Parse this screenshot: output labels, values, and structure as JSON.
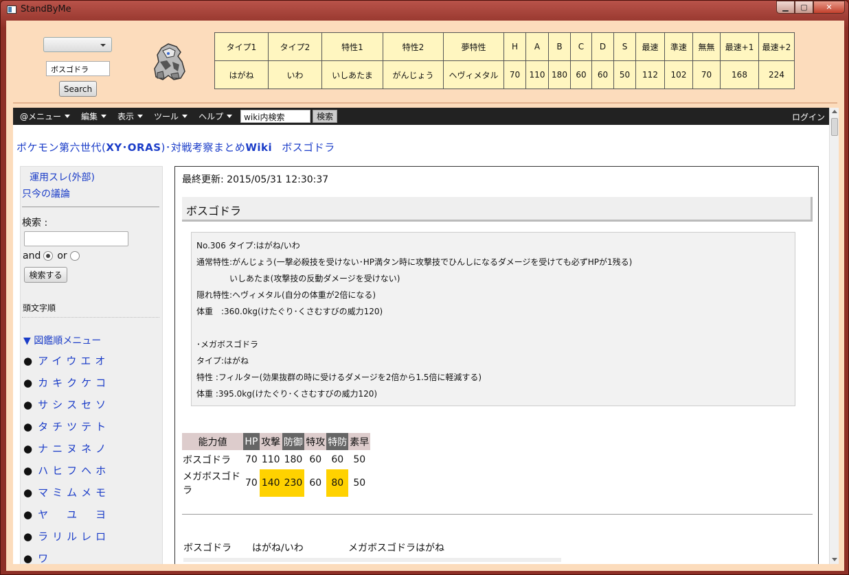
{
  "window": {
    "title": "StandByMe"
  },
  "panel": {
    "combo_value": "",
    "name_input": "ボスゴドラ",
    "search_label": "Search",
    "stats_headers": [
      "タイプ1",
      "タイプ2",
      "特性1",
      "特性2",
      "夢特性",
      "H",
      "A",
      "B",
      "C",
      "D",
      "S",
      "最速",
      "準速",
      "無無",
      "最速+1",
      "最速+2"
    ],
    "stats_values": [
      "はがね",
      "いわ",
      "いしあたま",
      "がんじょう",
      "ヘヴィメタル",
      "70",
      "110",
      "180",
      "60",
      "60",
      "50",
      "112",
      "102",
      "70",
      "168",
      "224"
    ]
  },
  "navbar": {
    "items": [
      "@メニュー",
      "編集",
      "表示",
      "ツール",
      "ヘルプ"
    ],
    "search_value": "wiki内検索",
    "search_button": "検索",
    "login": "ログイン"
  },
  "site": {
    "title_prefix": "ポケモン第六世代(",
    "title_bold": "XY･ORAS",
    "title_suffix": ")･対戦考察まとめ",
    "title_wiki": "Wiki",
    "page_name": "ボスゴドラ"
  },
  "sidebar": {
    "ext_link": "運用スレ(外部)",
    "discuss_link": "只今の議論",
    "search_label": "検索 :",
    "and_label": "and",
    "or_label": "or",
    "search_button": "検索する",
    "head_label": "頭文字順",
    "menu_title": "▼ 図鑑順メニュー",
    "kana": [
      "アイウエオ",
      "カキクケコ",
      "サシスセソ",
      "タチツテト",
      "ナニヌネノ",
      "ハヒフヘホ",
      "マミムメモ",
      "ヤ　ユ　ヨ",
      "ラリルレロ",
      "ワ"
    ]
  },
  "main": {
    "last_updated": "最終更新: 2015/05/31 12:30:37",
    "heading": "ボスゴドラ",
    "info": [
      "No.306 タイプ:はがね/いわ",
      "通常特性:がんじょう(一撃必殺技を受けない･HP満タン時に攻撃技でひんしになるダメージを受けても必ずHPが1残る)",
      "　　　　いしあたま(攻撃技の反動ダメージを受けない)",
      "隠れ特性:ヘヴィメタル(自分の体重が2倍になる)",
      "体重　:360.0kg(けたぐり･くさむすびの威力120)",
      "",
      "･メガボスゴドラ",
      "タイプ:はがね",
      "特性 :フィルター(効果抜群の時に受けるダメージを2倍から1.5倍に軽減する)",
      "体重 :395.0kg(けたぐり･くさむすびの威力120)"
    ],
    "stat_table": {
      "headers": [
        "能力値",
        "HP",
        "攻撃",
        "防御",
        "特攻",
        "特防",
        "素早"
      ],
      "rows": [
        [
          "ボスゴドラ",
          "70",
          "110",
          "180",
          "60",
          "60",
          "50"
        ],
        [
          "メガボスゴドラ",
          "70",
          "140",
          "230",
          "60",
          "80",
          "50"
        ]
      ]
    },
    "type_row": [
      "ボスゴドラ",
      "はがね/いわ",
      "メガボスゴドラ",
      "はがね"
    ]
  }
}
